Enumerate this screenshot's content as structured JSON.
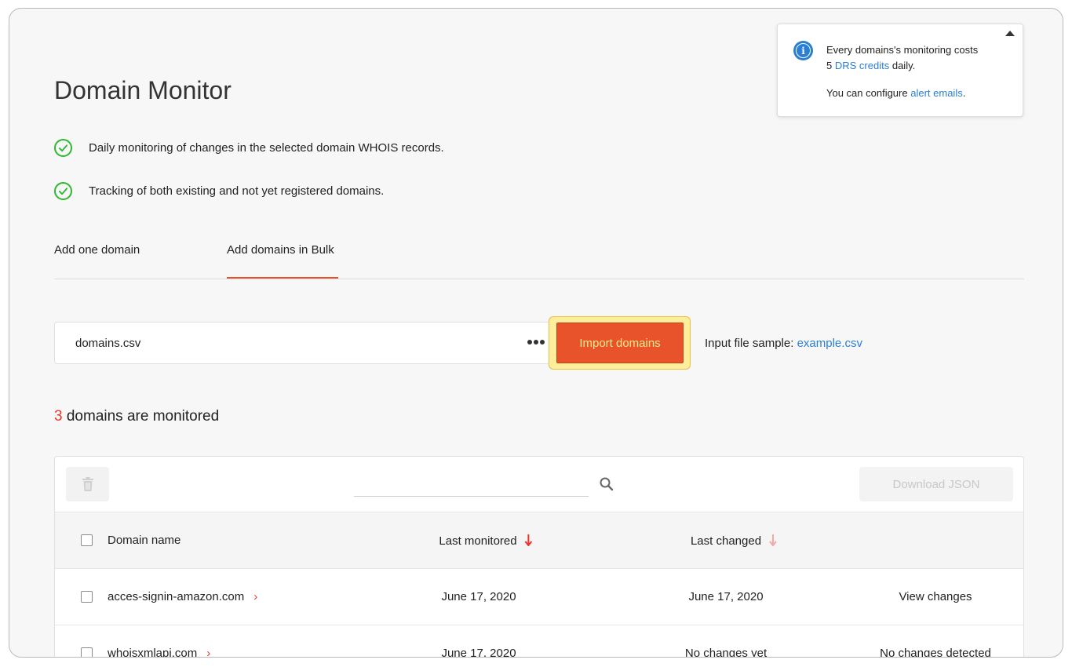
{
  "page": {
    "title": "Domain Monitor",
    "features": [
      "Daily monitoring of changes in the selected domain WHOIS records.",
      "Tracking of both existing and not yet registered domains."
    ]
  },
  "tabs": [
    {
      "label": "Add one domain",
      "active": false
    },
    {
      "label": "Add domains in Bulk",
      "active": true
    }
  ],
  "bulk": {
    "file_name": "domains.csv",
    "import_label": "Import domains",
    "sample_label": "Input file sample:",
    "sample_link": "example.csv"
  },
  "monitored": {
    "count": "3",
    "text": "domains are monitored"
  },
  "toolbar": {
    "search_placeholder": "",
    "download_label": "Download JSON"
  },
  "table": {
    "headers": {
      "domain": "Domain name",
      "last_monitored": "Last monitored",
      "last_changed": "Last changed"
    },
    "rows": [
      {
        "domain": "acces-signin-amazon.com",
        "last_monitored": "June 17, 2020",
        "last_changed": "June 17, 2020",
        "action": "View changes"
      },
      {
        "domain": "whoisxmlapi.com",
        "last_monitored": "June 17, 2020",
        "last_changed": "No changes yet",
        "action": "No changes detected"
      }
    ]
  },
  "info_popup": {
    "line1": "Every domains's monitoring costs",
    "line2_prefix": "5",
    "line2_link": "DRS credits",
    "line2_suffix": "daily.",
    "line3_prefix": "You can configure",
    "line3_link": "alert emails",
    "line3_suffix": "."
  },
  "colors": {
    "accent": "#e8532c",
    "link": "#2a7fd4",
    "check": "#2eb82e",
    "count": "#e8372c"
  }
}
